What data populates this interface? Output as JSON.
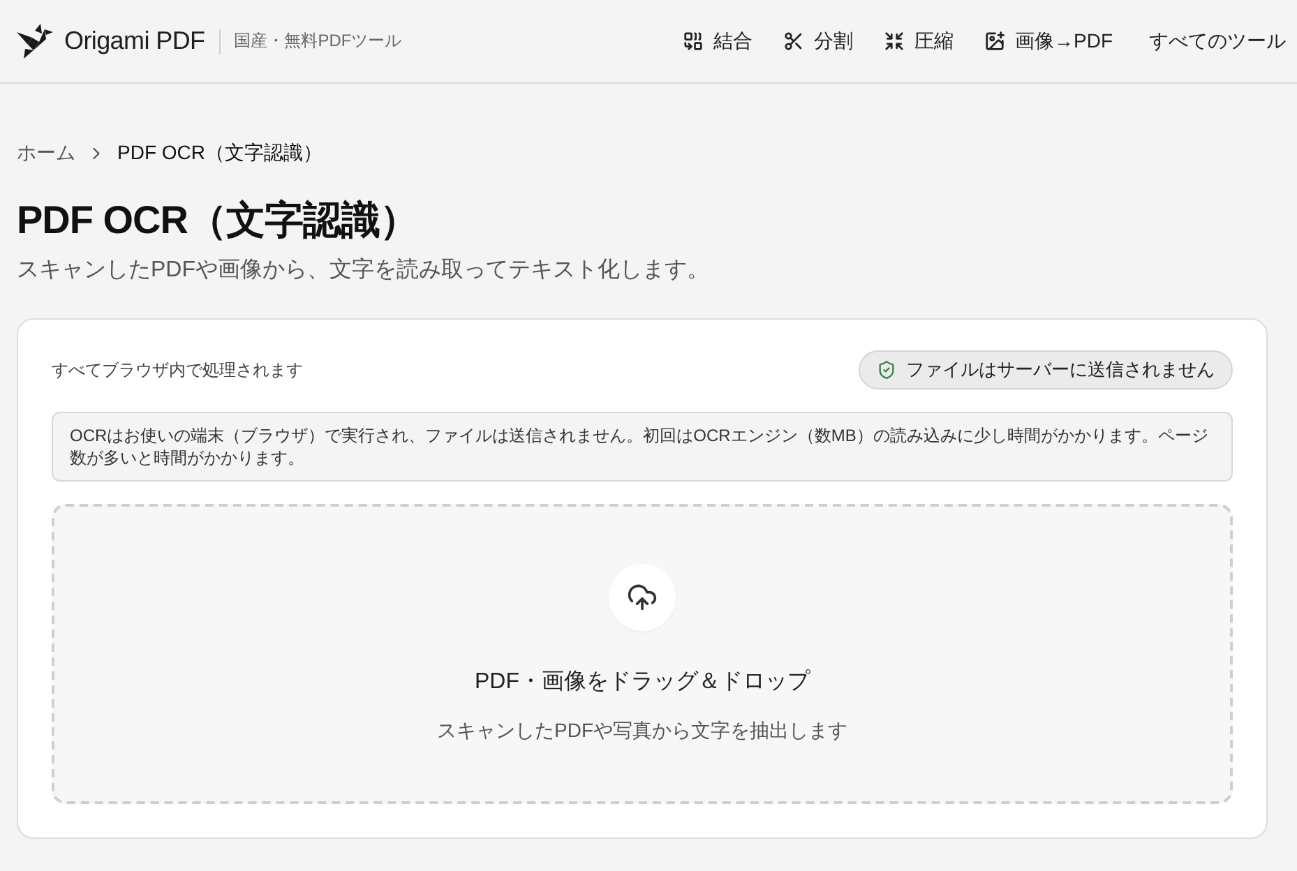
{
  "header": {
    "logo_text": "Origami PDF",
    "tagline": "国産・無料PDFツール",
    "nav": [
      {
        "label": "結合",
        "kind": "merge"
      },
      {
        "label": "分割",
        "kind": "split"
      },
      {
        "label": "圧縮",
        "kind": "compress"
      },
      {
        "label": "画像→PDF",
        "kind": "image"
      },
      {
        "label": "すべてのツール",
        "kind": "text"
      }
    ]
  },
  "breadcrumb": [
    {
      "label": "ホーム",
      "current": false
    },
    {
      "label": "PDF OCR（文字認識）",
      "current": true
    }
  ],
  "page": {
    "title": "PDF OCR（文字認識）",
    "subtitle": "スキャンしたPDFや画像から、文字を読み取ってテキスト化します。"
  },
  "tool": {
    "note": "すべてブラウザ内で処理されます",
    "badge": "ファイルはサーバーに送信されません",
    "info": "OCRはお使いの端末（ブラウザ）で実行され、ファイルは送信されません。初回はOCRエンジン（数MB）の読み込みに少し時間がかかります。ページ数が多いと時間がかかります。",
    "dropzone": {
      "title": "PDF・画像をドラッグ＆ドロップ",
      "hint": "スキャンしたPDFや写真から文字を抽出します"
    }
  }
}
